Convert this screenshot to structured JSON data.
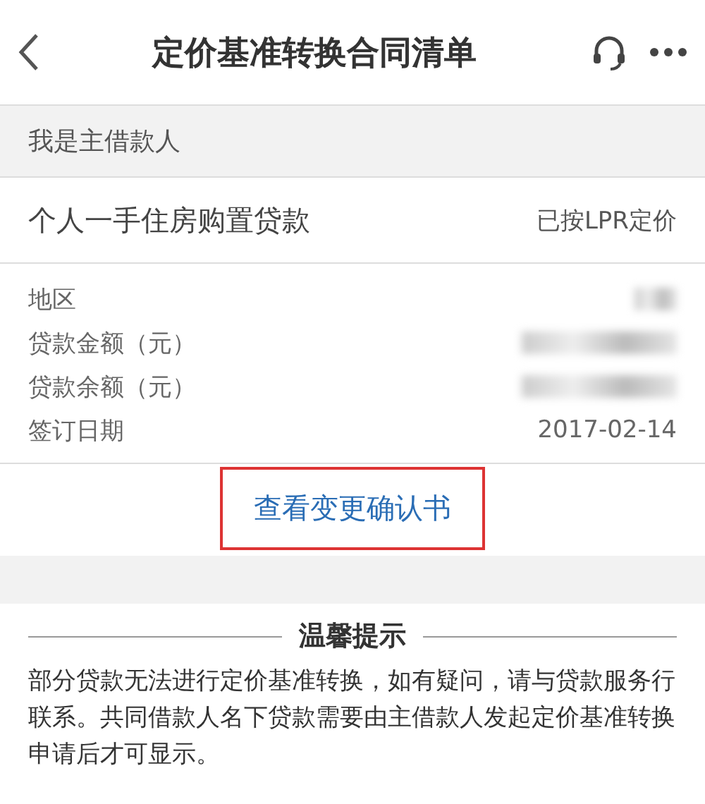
{
  "header": {
    "title": "定价基准转换合同清单"
  },
  "section": {
    "label": "我是主借款人"
  },
  "loan": {
    "name": "个人一手住房购置贷款",
    "status": "已按LPR定价"
  },
  "details": [
    {
      "label": "地区",
      "kind": "hidden"
    },
    {
      "label": "贷款金额（元）",
      "kind": "hidden"
    },
    {
      "label": "贷款余额（元）",
      "kind": "hidden"
    },
    {
      "label": "签订日期",
      "kind": "text",
      "value": "2017-02-14"
    }
  ],
  "link": {
    "label": "查看变更确认书",
    "highlighted": true
  },
  "notice": {
    "title": "温馨提示",
    "text": "部分贷款无法进行定价基准转换，如有疑问，请与贷款服务行联系。共同借款人名下贷款需要由主借款人发起定价基准转换申请后才可显示。"
  }
}
